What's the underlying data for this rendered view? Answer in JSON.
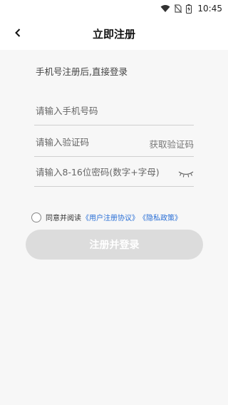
{
  "status_bar": {
    "time": "10:45",
    "icons": [
      "wifi-icon",
      "no-sim-icon",
      "battery-icon"
    ]
  },
  "header": {
    "title": "立即注册",
    "back_icon": "chevron-left-icon"
  },
  "form": {
    "hint": "手机号注册后,直接登录",
    "phone_placeholder": "请输入手机号码",
    "code_placeholder": "请输入验证码",
    "get_code_label": "获取验证码",
    "password_placeholder": "请输入8-16位密码(数字+字母)",
    "password_toggle_icon": "eye-closed-icon"
  },
  "agreement": {
    "prefix": "同意并阅读",
    "user_agreement": "《用户注册协议》",
    "privacy_policy": "《隐私政策》",
    "checked": false
  },
  "submit": {
    "label": "注册并登录",
    "enabled": false
  },
  "colors": {
    "link": "#2a6fd6",
    "button_disabled": "#dcdcdc",
    "background": "#f7f7f7"
  }
}
